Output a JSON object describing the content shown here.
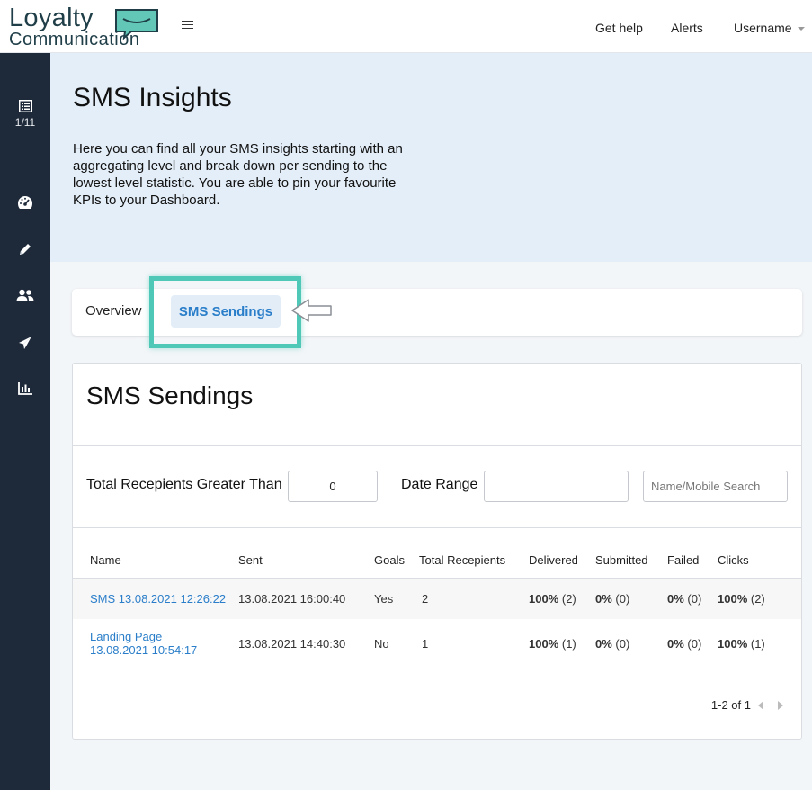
{
  "app": {
    "logo_line1": "Loyalty",
    "logo_line2": "Communication",
    "brand_color": "#1f3e48",
    "accent_color": "#4fc8b8"
  },
  "topnav": {
    "help": "Get help",
    "alerts": "Alerts",
    "user": "Username"
  },
  "sidebar": {
    "items": [
      {
        "icon": "list-icon",
        "label": "1/11"
      },
      {
        "icon": "dashboard-gauge-icon"
      },
      {
        "icon": "pencil-icon"
      },
      {
        "icon": "users-icon"
      },
      {
        "icon": "paper-plane-icon"
      },
      {
        "icon": "bar-chart-icon"
      }
    ]
  },
  "hero": {
    "title": "SMS Insights",
    "description": "Here you can find all your SMS insights starting with an aggregating level and break down per sending to the lowest level statistic. You are able to pin your favourite KPIs to your Dashboard."
  },
  "tabs": {
    "overview": "Overview",
    "sms_sendings": "SMS Sendings"
  },
  "card": {
    "title": "SMS Sendings",
    "filters": {
      "recipients_label": "Total Recepients Greater Than",
      "recipients_value": "0",
      "date_label": "Date Range",
      "date_value": "",
      "search_placeholder": "Name/Mobile Search"
    },
    "columns": [
      "Name",
      "Sent",
      "Goals",
      "Total Recepients",
      "Delivered",
      "Submitted",
      "Failed",
      "Clicks"
    ],
    "rows": [
      {
        "name": "SMS 13.08.2021 12:26:22",
        "sent": "13.08.2021 16:00:40",
        "goals": "Yes",
        "total": "2",
        "delivered_pct": "100%",
        "delivered_count": "(2)",
        "submitted_pct": "0%",
        "submitted_count": "(0)",
        "failed_pct": "0%",
        "failed_count": "(0)",
        "clicks_pct": "100%",
        "clicks_count": "(2)"
      },
      {
        "name": "Landing Page 13.08.2021 10:54:17",
        "sent": "13.08.2021 14:40:30",
        "goals": "No",
        "total": "1",
        "delivered_pct": "100%",
        "delivered_count": "(1)",
        "submitted_pct": "0%",
        "submitted_count": "(0)",
        "failed_pct": "0%",
        "failed_count": "(0)",
        "clicks_pct": "100%",
        "clicks_count": "(1)"
      }
    ],
    "pagination": "1-2 of 1"
  }
}
